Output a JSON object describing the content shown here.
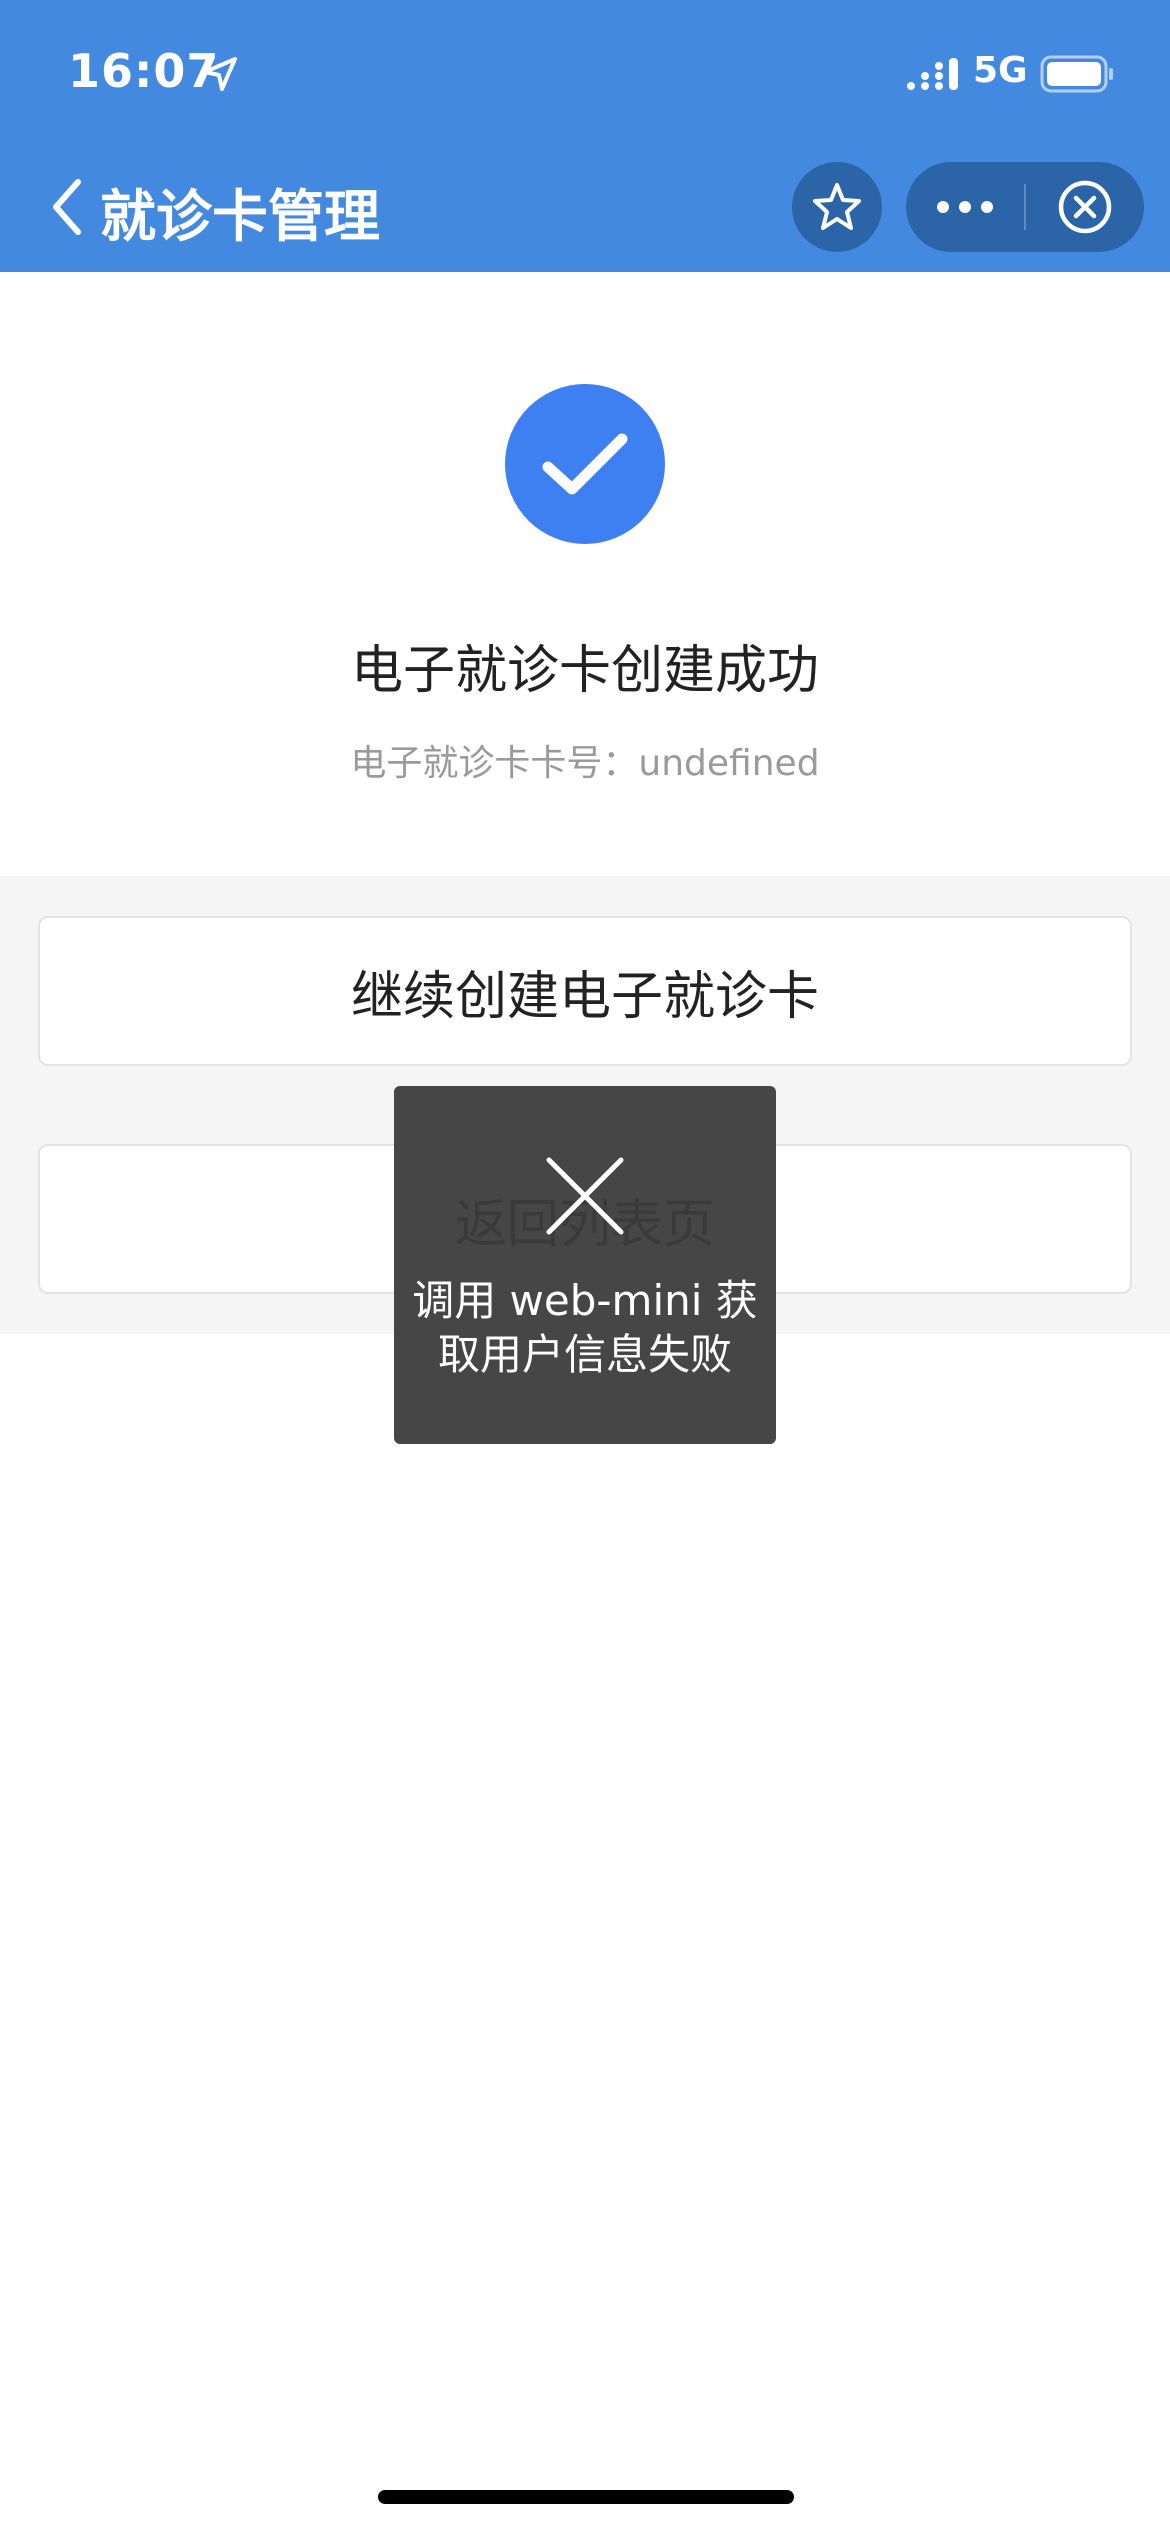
{
  "status_bar": {
    "time": "16:07",
    "network": "5G",
    "icons": [
      "location-arrow-icon",
      "signal-bars-icon",
      "battery-icon"
    ]
  },
  "nav_bar": {
    "title": "就诊卡管理",
    "icons": [
      "chevron-left-icon",
      "star-icon",
      "more-dots-icon",
      "close-circle-icon"
    ]
  },
  "success": {
    "icon": "checkmark-icon",
    "title": "电子就诊卡创建成功",
    "card_number_line": "电子就诊卡卡号：undefined"
  },
  "actions": {
    "continue_label": "继续创建电子就诊卡",
    "back_label": "返回列表页"
  },
  "toast": {
    "icon": "x-icon",
    "message": "调用 web-mini 获取用户信息失败"
  },
  "colors": {
    "header": "#4389e0",
    "capsule": "#2b65a8",
    "success_accent": "#3e7ff2",
    "action_area": "#f5f5f5",
    "toast": "#3c3c3c"
  }
}
